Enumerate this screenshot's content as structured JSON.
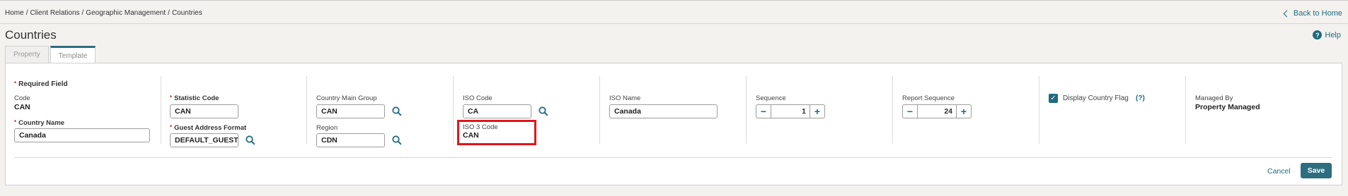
{
  "breadcrumb": [
    "Home",
    "Client Relations",
    "Geographic Management",
    "Countries"
  ],
  "back_home": "Back to Home",
  "page_title": "Countries",
  "help": "Help",
  "tabs": [
    {
      "label": "Property"
    },
    {
      "label": "Template"
    }
  ],
  "active_tab": "Template",
  "required_field": "Required Field",
  "fields": {
    "code": {
      "label": "Code",
      "value": "CAN"
    },
    "country_name": {
      "label": "Country Name",
      "value": "Canada"
    },
    "statistic_code": {
      "label": "Statistic Code",
      "value": "CAN"
    },
    "guest_address_format": {
      "label": "Guest Address Format",
      "value": "DEFAULT_GUEST"
    },
    "country_main_group": {
      "label": "Country Main Group",
      "value": "CAN"
    },
    "region": {
      "label": "Region",
      "value": "CDN"
    },
    "iso_code": {
      "label": "ISO Code",
      "value": "CA"
    },
    "iso3_code": {
      "label": "ISO 3 Code",
      "value": "CAN"
    },
    "iso_name": {
      "label": "ISO Name",
      "value": "Canada"
    },
    "sequence": {
      "label": "Sequence",
      "value": "1"
    },
    "report_sequence": {
      "label": "Report Sequence",
      "value": "24"
    },
    "display_country_flag": {
      "label": "Display Country Flag",
      "checked": true,
      "help": "(?)"
    },
    "managed_by": {
      "label": "Managed By",
      "value": "Property Managed"
    }
  },
  "actions": {
    "cancel": "Cancel",
    "save": "Save"
  },
  "colors": {
    "accent": "#1f6b80",
    "highlight": "#e3141b",
    "required": "#c2272d"
  }
}
